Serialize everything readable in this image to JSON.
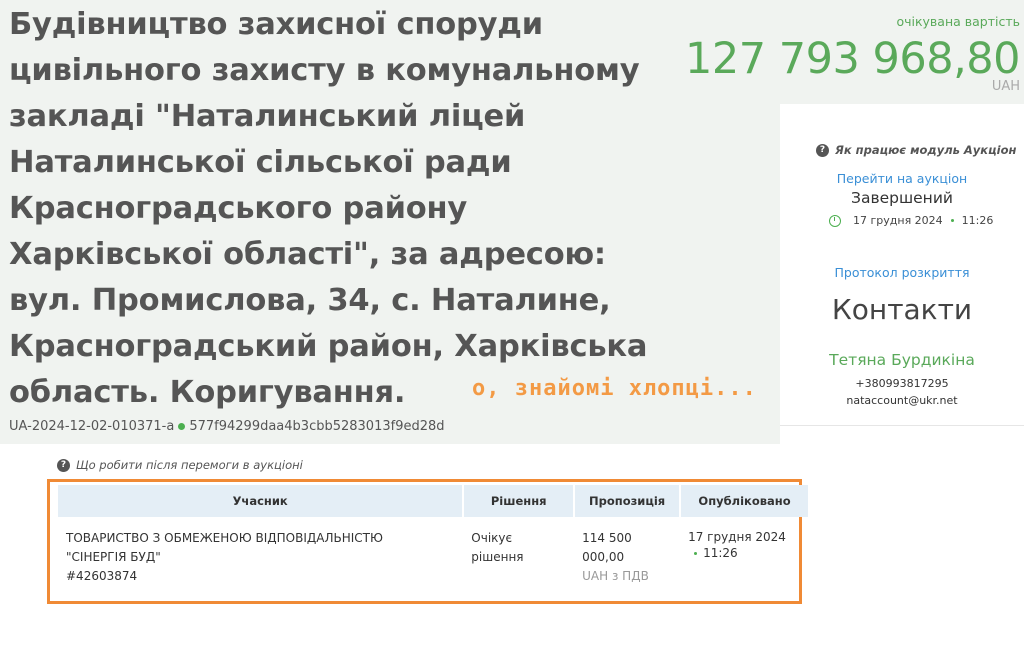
{
  "tender": {
    "title": "Будівництво захисної споруди цивільного захисту в комунальному закладі \"Наталинський ліцей Наталинської сільської ради Красноградського району Харківської області\", за адресою: вул. Промислова, 34, с. Наталине, Красноградський район, Харківська область. Коригування.",
    "id": "UA-2024-12-02-010371-a",
    "hash": "577f94299daa4b3cbb5283013f9ed28d"
  },
  "expected_value": {
    "label": "очікувана вартість",
    "amount": "127 793 968,80",
    "currency": "UAH"
  },
  "auction": {
    "help_text": "Як працює модуль Аукціон",
    "go_to_auction": "Перейти на аукціон",
    "status": "Завершений",
    "date": "17 грудня 2024",
    "time": "11:26",
    "protocol_link": "Протокол розкриття"
  },
  "contacts": {
    "title": "Контакти",
    "name": "Тетяна Бурдикіна",
    "phone": "+380993817295",
    "email": "nataccount@ukr.net"
  },
  "annotation": "о, знайомі хлопці...",
  "after_win_help": "Що робити після перемоги в аукціоні",
  "bids_table": {
    "headers": [
      "Учасник",
      "Рішення",
      "Пропозиція",
      "Опубліковано"
    ],
    "rows": [
      {
        "participant_line1": "ТОВАРИСТВО З ОБМЕЖЕНОЮ ВІДПОВІДАЛЬНІСТЮ",
        "participant_line2": "\"СІНЕРГІЯ БУД\"",
        "participant_code": "#42603874",
        "decision_line1": "Очікує",
        "decision_line2": "рішення",
        "offer_line1": "114 500",
        "offer_line2": "000,00",
        "offer_line3": "UAH з ПДВ",
        "published_date": "17 грудня 2024",
        "published_time": "11:26"
      }
    ]
  },
  "colors": {
    "accent_green": "#5aa95a",
    "link_blue": "#3a8fd6",
    "highlight_orange": "#f08a35",
    "header_bg": "#f0f3f0",
    "table_header_bg": "#e4eef6"
  }
}
